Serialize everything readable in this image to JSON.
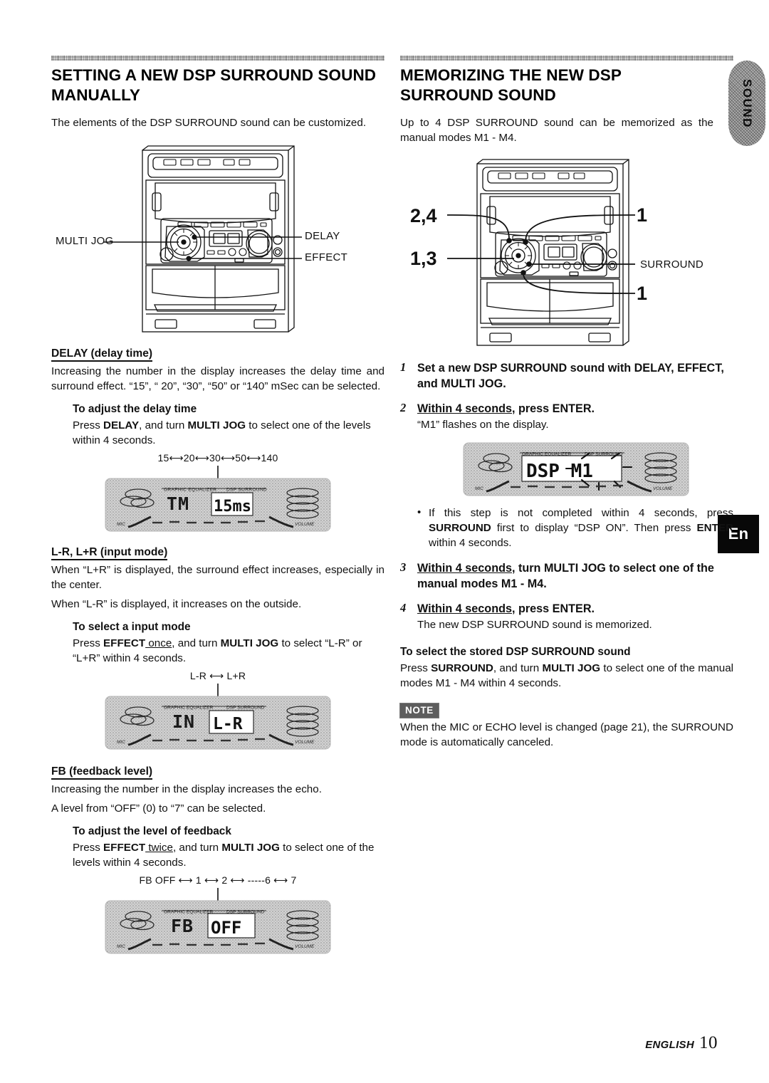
{
  "page": {
    "footer_label": "ENGLISH",
    "footer_page": "10",
    "side_tab_label": "SOUND",
    "lang_badge": "En"
  },
  "left_column": {
    "title": "SETTING A NEW DSP SURROUND SOUND MANUALLY",
    "intro": "The elements of the DSP SURROUND sound can be customized.",
    "diagram": {
      "name": "stereo-system-front",
      "callouts": [
        {
          "label": "MULTI JOG",
          "side": "left"
        },
        {
          "label": "DELAY",
          "side": "right"
        },
        {
          "label": "EFFECT",
          "side": "right"
        }
      ]
    },
    "delay": {
      "heading": "DELAY (delay time)",
      "body_1": "Increasing the number in the display increases the delay time and surround effect. “15”, “ 20”, “30”, “50” or “140” mSec can be selected.",
      "howto_title": "To adjust the delay time",
      "howto_pre": "Press ",
      "howto_b1": "DELAY",
      "howto_mid": ", and turn ",
      "howto_b2": "MULTI JOG",
      "howto_post": " to select one of the levels within 4 seconds.",
      "sequence": "15⟷20⟷30⟷50⟷140",
      "lcd": {
        "left_text": "TM",
        "boxed_text": "15ms",
        "top_labels": "GRAPHIC EQUALIZER   DSP SURROUND",
        "mic": "MIC",
        "vol": "VOLUME"
      }
    },
    "input_mode": {
      "heading": "L-R, L+R (input mode)",
      "body_1": "When “L+R” is displayed, the surround effect increases, especially in the center.",
      "body_2": "When “L-R” is displayed, it increases on the outside.",
      "howto_title": "To select a input mode",
      "howto_pre": "Press ",
      "howto_b1": "EFFECT",
      "howto_u": " once",
      "howto_mid": ", and turn ",
      "howto_b2": "MULTI JOG",
      "howto_post": " to select “L-R” or “L+R” within 4 seconds.",
      "sequence": "L-R ⟷ L+R",
      "lcd": {
        "left_text": "IN",
        "boxed_text": "L-R",
        "top_labels": "GRAPHIC EQUALIZER   DSP SURROUND",
        "mic": "MIC",
        "vol": "VOLUME"
      }
    },
    "feedback": {
      "heading": "FB (feedback level)",
      "body_1": "Increasing the number in the display increases the echo.",
      "body_2": "A level from “OFF” (0) to “7” can be selected.",
      "howto_title": "To adjust the level of feedback",
      "howto_pre": "Press ",
      "howto_b1": "EFFECT",
      "howto_u": " twice",
      "howto_mid": ", and turn ",
      "howto_b2": "MULTI JOG",
      "howto_post": " to select one of the levels within 4 seconds.",
      "sequence": "FB OFF ⟷ 1 ⟷ 2 ⟷ -----6 ⟷ 7",
      "lcd": {
        "left_text": "FB",
        "boxed_text": "OFF",
        "top_labels": "GRAPHIC EQUALIZER   DSP SURROUND",
        "mic": "MIC",
        "vol": "VOLUME"
      }
    }
  },
  "right_column": {
    "title": "MEMORIZING THE NEW DSP SURROUND SOUND",
    "intro": "Up to 4 DSP SURROUND sound can be memorized as the manual modes M1 - M4.",
    "diagram": {
      "name": "stereo-system-front",
      "callouts": [
        {
          "label": "2,4",
          "side": "left"
        },
        {
          "label": "1,3",
          "side": "left"
        },
        {
          "label": "1",
          "side": "right"
        },
        {
          "label": "SURROUND",
          "side": "right"
        },
        {
          "label": "1",
          "side": "right"
        }
      ]
    },
    "steps": [
      {
        "num": "1",
        "text": "Set a new DSP SURROUND sound with DELAY, EFFECT, and MULTI JOG.",
        "sub": ""
      },
      {
        "num": "2",
        "text_u": "Within 4 seconds",
        "text_rest": ", press ENTER.",
        "sub": "“M1” flashes on the display."
      },
      {
        "num": "3",
        "text_u": "Within 4 seconds",
        "text_rest": ", turn MULTI JOG to select one of the manual modes M1 - M4.",
        "sub": ""
      },
      {
        "num": "4",
        "text_u": "Within 4 seconds",
        "text_rest": ", press ENTER.",
        "sub": "The new DSP SURROUND sound is memorized."
      }
    ],
    "step2_lcd": {
      "boxed_text": "DSP M1",
      "top_labels": "GRAPHIC EQUALIZER   DSP SURROUND",
      "mic": "MIC",
      "vol": "VOLUME"
    },
    "bullet": {
      "pre": "If this step is not completed within 4 seconds, press ",
      "b1": "SURROUND",
      "mid": " first to display “DSP ON”. Then press ",
      "b2": "ENTER",
      "post": " within 4 seconds."
    },
    "stored": {
      "title": "To select the stored DSP SURROUND sound",
      "pre": "Press ",
      "b1": "SURROUND",
      "mid": ", and turn ",
      "b2": "MULTI JOG",
      "post": " to select one of the manual modes M1 - M4 within 4 seconds."
    },
    "note": {
      "badge": "NOTE",
      "text": "When the MIC or ECHO level is changed (page 21), the SURROUND mode is automatically canceled."
    }
  },
  "colors": {
    "ink": "#111111",
    "note_badge_bg": "#5d5d5d",
    "lang_badge_bg": "#080808"
  }
}
